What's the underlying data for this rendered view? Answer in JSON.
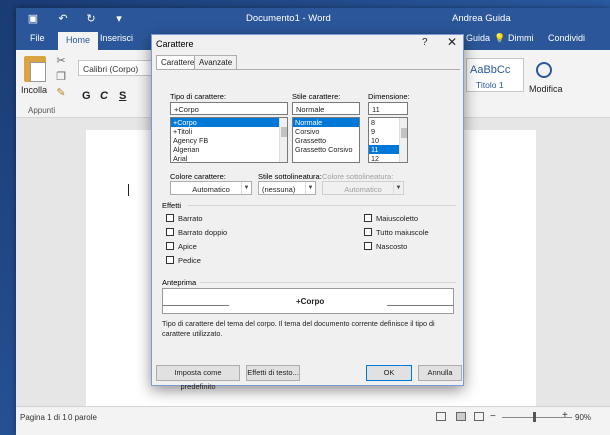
{
  "window": {
    "doc_title": "Documento1 - Word",
    "user": "Andrea Guida"
  },
  "ribbon": {
    "tabs": [
      "File",
      "Home",
      "Inserisci"
    ],
    "tabs_right": [
      "Guida",
      "Dimmi",
      "Condividi"
    ],
    "font_box": "Calibri (Corpo)",
    "paste_label": "Incolla",
    "clipboard_group": "Appunti",
    "fmt_buttons": [
      "G",
      "C",
      "S"
    ],
    "style_sample": "AaBbCc",
    "style_name": "Titolo 1",
    "modify_label": "Modifica"
  },
  "status": {
    "page": "Pagina 1 di 1",
    "words": "0 parole",
    "zoom": "90%"
  },
  "dialog": {
    "title": "Carattere",
    "help": "?",
    "close": "✕",
    "tabs": [
      "Carattere",
      "Avanzate"
    ],
    "font": {
      "label": "Tipo di carattere:",
      "value": "+Corpo",
      "options": [
        "+Corpo",
        "+Titoli",
        "Agency FB",
        "Algerian",
        "Arial"
      ],
      "selected": 0
    },
    "style": {
      "label": "Stile carattere:",
      "value": "Normale",
      "options": [
        "Normale",
        "Corsivo",
        "Grassetto",
        "Grassetto Corsivo"
      ],
      "selected": 0
    },
    "size": {
      "label": "Dimensione:",
      "value": "11",
      "options": [
        "8",
        "9",
        "10",
        "11",
        "12"
      ],
      "selected": 3
    },
    "color": {
      "label": "Colore carattere:",
      "value": "Automatico"
    },
    "underline": {
      "label": "Stile sottolineatura:",
      "value": "(nessuna)"
    },
    "underline_color": {
      "label": "Colore sottolineatura:",
      "value": "Automatico"
    },
    "effects_label": "Effetti",
    "effects_left": [
      "Barrato",
      "Barrato doppio",
      "Apice",
      "Pedice"
    ],
    "effects_right": [
      "Maiuscoletto",
      "Tutto maiuscole",
      "Nascosto"
    ],
    "preview_label": "Anteprima",
    "preview_text": "+Corpo",
    "description": "Tipo di carattere del tema del corpo. Il tema del documento corrente definisce il tipo di carattere utilizzato.",
    "buttons": {
      "set_default": "Imposta come predefinito",
      "text_effects": "Effetti di testo...",
      "ok": "OK",
      "cancel": "Annulla"
    }
  }
}
